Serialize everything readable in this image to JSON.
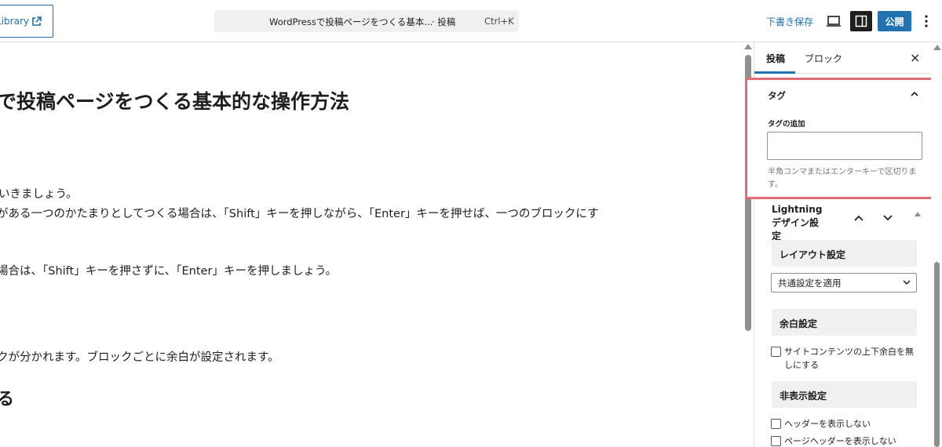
{
  "header": {
    "library_label": "Library",
    "doc_title": "WordPressで投稿ページをつくる基本...",
    "doc_type": "· 投稿",
    "shortcut": "Ctrl+K",
    "draft_label": "下書き保存",
    "publish_label": "公開"
  },
  "canvas": {
    "title": "で投稿ページをつくる基本的な操作方法",
    "paragraphs": [
      "いきましょう。",
      "がある一つのかたまりとしてつくる場合は、「Shift」キーを押しながら、「Enter」キーを押せば、一つのブロックにす",
      "場合は、「Shift」キーを押さずに、「Enter」キーを押しましょう。",
      "クが分かれます。ブロックごとに余白が設定されます。"
    ],
    "heading2": "る"
  },
  "sidebar": {
    "tab_post": "投稿",
    "tab_block": "ブロック",
    "close": "×",
    "tags": {
      "heading": "タグ",
      "add_label": "タグの追加",
      "input_value": "",
      "help": "半角コンマまたはエンターキーで区切ります。"
    },
    "lightning": {
      "heading": "Lightning デザイン設定",
      "layout_heading": "レイアウト設定",
      "layout_value": "共通設定を適用",
      "margin_heading": "余白設定",
      "margin_checkbox": "サイトコンテンツの上下余白を無しにする",
      "hide_heading": "非表示設定",
      "hide_header": "ヘッダーを表示しない",
      "hide_page_header": "ページヘッダーを表示しない"
    }
  },
  "colors": {
    "accent": "#2271b1",
    "highlight_border": "#e06c75",
    "dark": "#1e1e1e"
  }
}
